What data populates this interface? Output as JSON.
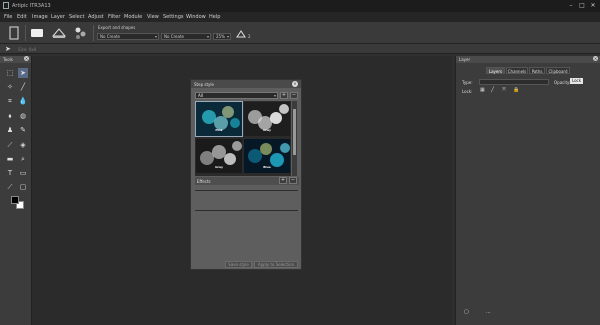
{
  "app": {
    "title": "Artipic ITR3A13"
  },
  "window_controls": [
    "–",
    "□",
    "✕"
  ],
  "menu": [
    "File",
    "Edit",
    "Image",
    "Layer",
    "Select",
    "Adjust",
    "Filter",
    "Module",
    "View",
    "Settings",
    "Window",
    "Help"
  ],
  "toolbar": {
    "export_label": "Export and shapes",
    "select1": "No Create",
    "select2": "No Create",
    "select3": "25%",
    "select4": "2"
  },
  "options": {
    "dimensions": "Size: 0x0"
  },
  "tools_panel": {
    "title": "Tools",
    "fg_color": "#000000",
    "bg_color": "#ffffff"
  },
  "dialog": {
    "title": "Step style",
    "filter_value": "All",
    "thumbs": [
      "Pink",
      "Gray",
      "Gray",
      "Blue"
    ],
    "effects_label": "Effects",
    "ok_label": "Save style",
    "cancel_label": "Apply to Selection"
  },
  "layers_panel": {
    "title": "Layer",
    "tabs": [
      "Layers",
      "Channels",
      "Paths",
      "Clipboard"
    ],
    "type_label": "Type:",
    "opacity_label": "Opacity:",
    "blend_value": "Lock",
    "lock_label": "Lock:"
  }
}
